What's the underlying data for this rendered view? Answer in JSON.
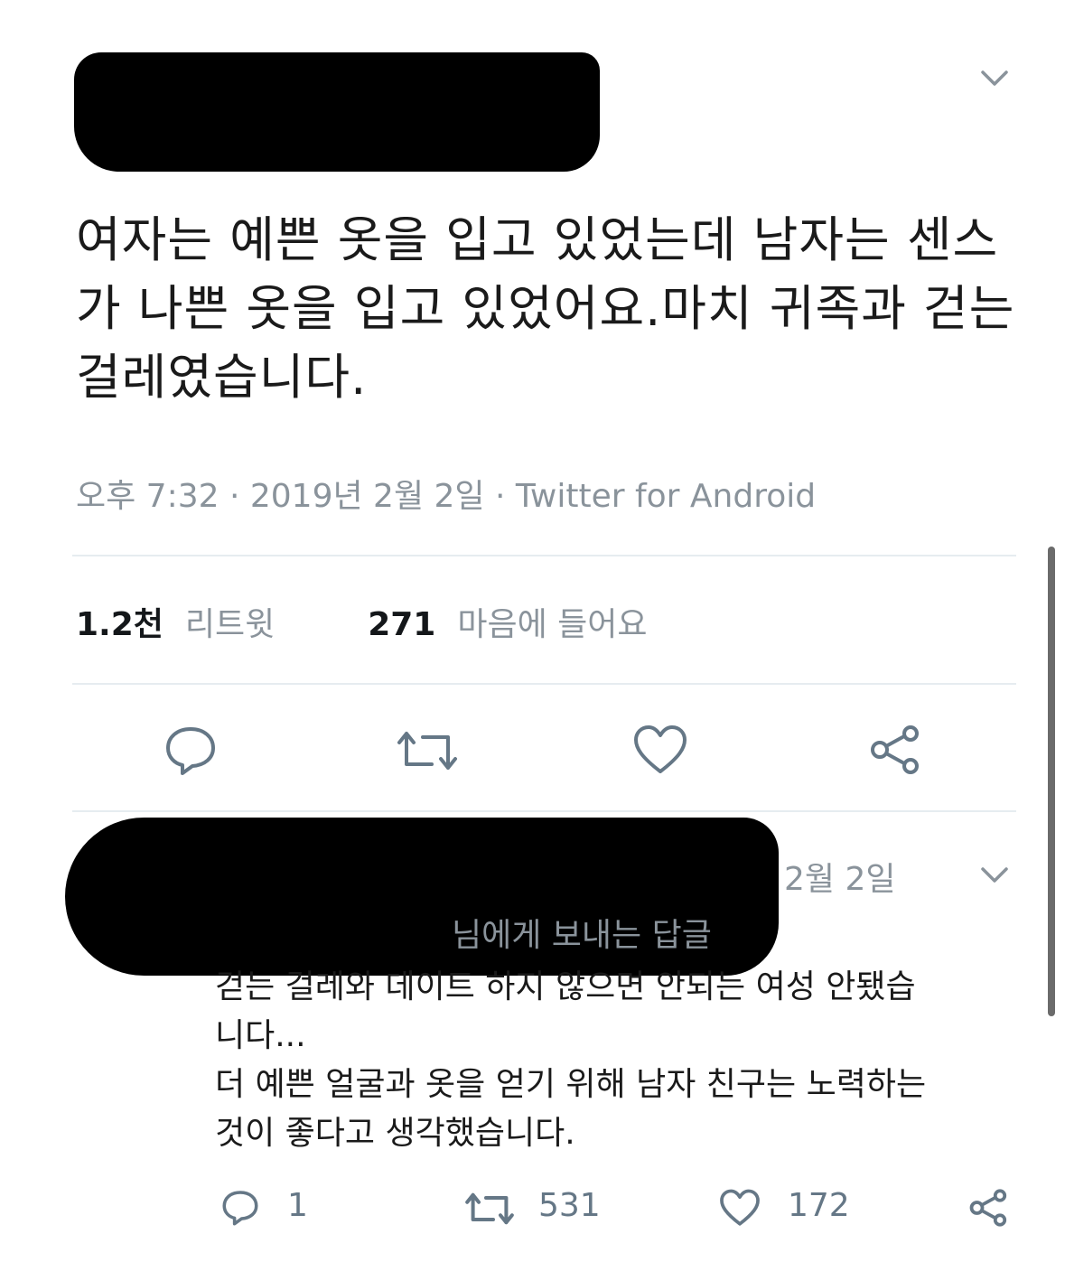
{
  "tweet": {
    "text": "여자는 예쁜 옷을 입고 있었는데 남자는 센스가 나쁜 옷을 입고 있었어요.마치 귀족과 걷는 걸레였습니다.",
    "meta": "오후 7:32 · 2019년 2월 2일 · Twitter for Android",
    "stats": {
      "retweet_count": "1.2천",
      "retweet_label": "리트윗",
      "like_count": "271",
      "like_label": "마음에 들어요"
    },
    "icons": [
      "reply-icon",
      "retweet-icon",
      "heart-icon",
      "share-icon",
      "chevron-down-icon"
    ]
  },
  "reply": {
    "date": "2월 2일",
    "replying_to": "님에게 보내는 답글",
    "text": "걷는 걸레와 데이트 하지 않으면 안되는 여성 안됐습\n니다...\n더 예쁜 얼굴과 옷을 얻기 위해 남자 친구는 노력하는\n것이 좋다고 생각했습니다.",
    "actions": {
      "reply_count": "1",
      "retweet_count": "531",
      "like_count": "172"
    }
  },
  "colors": {
    "text": "#14171a",
    "secondary": "#8a939b",
    "divider": "#e6ecf0",
    "icon": "#657786",
    "redaction": "#000000"
  }
}
